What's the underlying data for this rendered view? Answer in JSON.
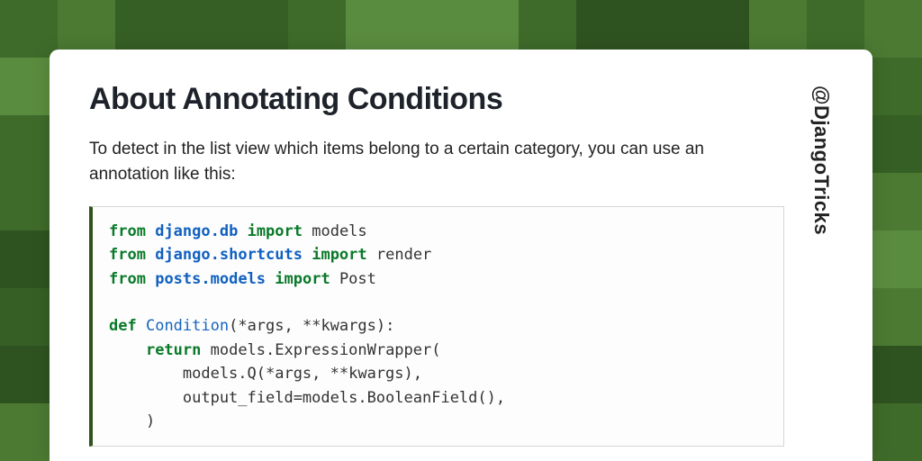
{
  "title": "About Annotating Conditions",
  "handle": "@DjangoTricks",
  "intro": "To detect in the list view which items belong to a certain category, you can use an annotation like this:",
  "code": {
    "l1_kw": "from",
    "l1_ns": "django.db",
    "l1_kw2": "import",
    "l1_rest": " models",
    "l2_kw": "from",
    "l2_ns": "django.shortcuts",
    "l2_kw2": "import",
    "l2_rest": " render",
    "l3_kw": "from",
    "l3_ns": "posts.models",
    "l3_kw2": "import",
    "l3_rest": " Post",
    "l4": "",
    "l5_kw": "def",
    "l5_fn": "Condition",
    "l5_rest": "(*args, **kwargs):",
    "l6_kw": "return",
    "l6_rest": " models.ExpressionWrapper(",
    "l7": "        models.Q(*args, **kwargs),",
    "l8": "        output_field=models.BooleanField(),",
    "l9": "    )"
  }
}
